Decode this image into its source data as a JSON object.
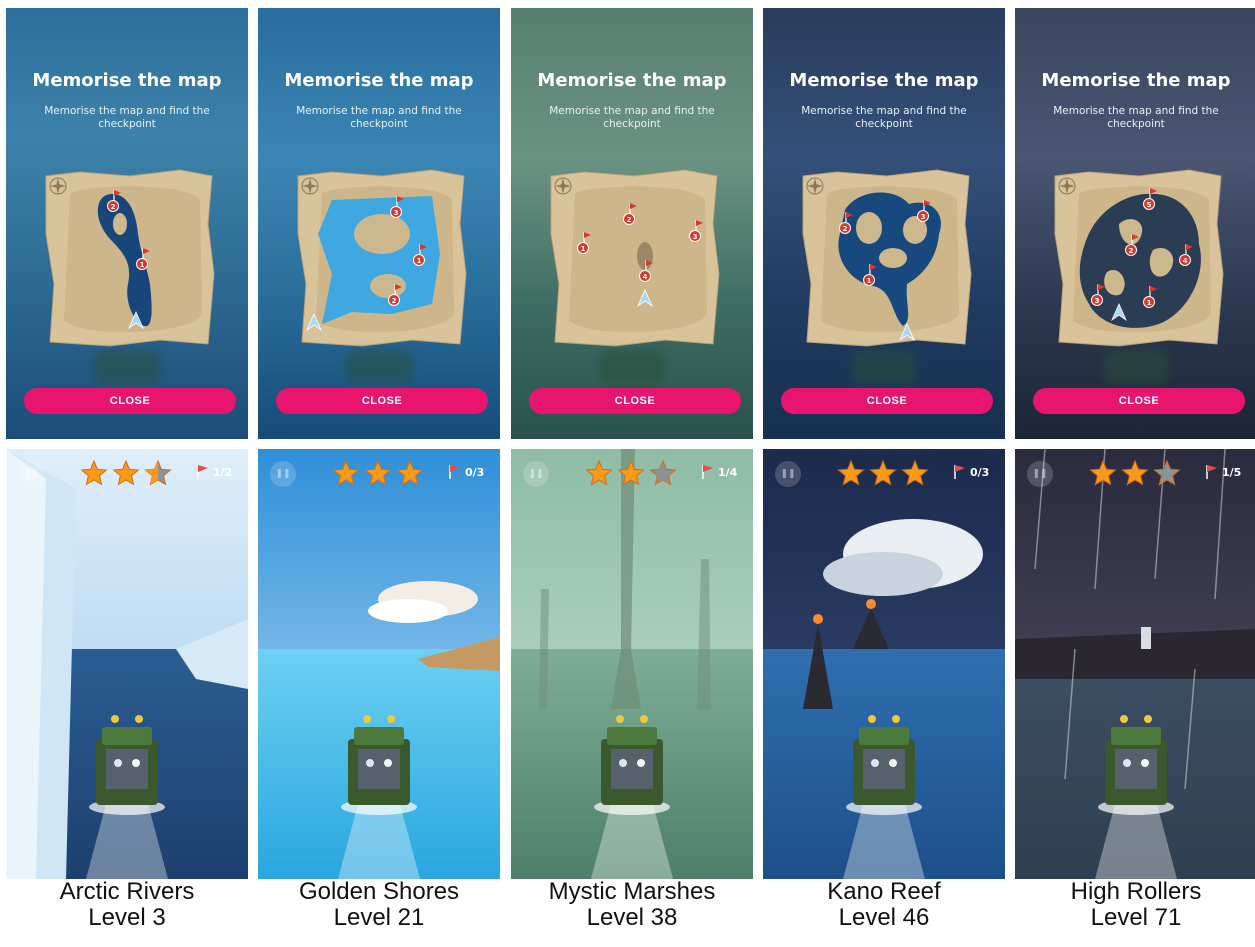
{
  "dialog": {
    "title": "Memorise the map",
    "subtitle": "Memorise the map and find the checkpoint",
    "close_label": "CLOSE"
  },
  "levels": [
    {
      "name": "Arctic Rivers",
      "level": "Level 3",
      "flags": "1/2",
      "stars_earned": 2.5,
      "stars_total": 3,
      "checkpoints": [
        "2",
        "1"
      ]
    },
    {
      "name": "Golden Shores",
      "level": "Level 21",
      "flags": "0/3",
      "stars_earned": 3,
      "stars_total": 3,
      "checkpoints": [
        "3",
        "1",
        "2"
      ]
    },
    {
      "name": "Mystic Marshes",
      "level": "Level 38",
      "flags": "1/4",
      "stars_earned": 2,
      "stars_total": 3,
      "checkpoints": [
        "2",
        "3",
        "1",
        "4"
      ]
    },
    {
      "name": "Kano Reef",
      "level": "Level 46",
      "flags": "0/3",
      "stars_earned": 3,
      "stars_total": 3,
      "checkpoints": [
        "2",
        "3",
        "1"
      ]
    },
    {
      "name": "High Rollers",
      "level": "Level 71",
      "flags": "1/5",
      "stars_earned": 2,
      "stars_total": 3,
      "checkpoints": [
        "5",
        "2",
        "4",
        "3",
        "1"
      ]
    }
  ],
  "colors": {
    "close_button": "#e8156e",
    "star_gold": "#f59a1b",
    "star_grey": "#8c9398",
    "checkpoint_red": "#d9382c",
    "parchment": "#d8c39a"
  },
  "icons": [
    "pause-icon",
    "star-icon",
    "flag-icon",
    "compass-icon",
    "player-arrow-icon",
    "checkpoint-flag-icon"
  ]
}
